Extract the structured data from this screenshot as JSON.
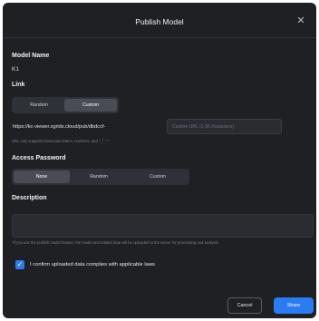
{
  "dialog": {
    "title": "Publish Model"
  },
  "model_name": {
    "label": "Model Name",
    "value": "K1"
  },
  "link": {
    "label": "Link",
    "options": [
      "Random",
      "Custom"
    ],
    "selected": "Custom",
    "url_prefix": "https://kc-viewer.xgrids.cloud/pub/dbdccf-",
    "custom_url_placeholder": "Custom URL (1-36 characters)",
    "hint": "URL only supports lowercase letters, numbers, and \"_\", \"-\""
  },
  "access_password": {
    "label": "Access Password",
    "options": [
      "None",
      "Random",
      "Custom"
    ],
    "selected": "None"
  },
  "description": {
    "label": "Description",
    "value": ""
  },
  "notice": "*If you use the publish model feature, the model and related data will be uploaded to the server for processing and analysis.",
  "confirm": {
    "checked": true,
    "label": "I confirm uploaded data complies with applicable laws"
  },
  "buttons": {
    "cancel": "Cancel",
    "share": "Share"
  },
  "colors": {
    "accent": "#2a7cf2",
    "dialog_bg": "#1f2024"
  }
}
